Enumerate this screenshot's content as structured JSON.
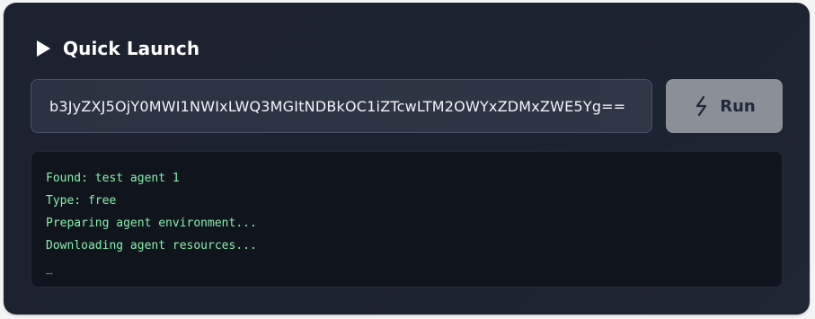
{
  "header": {
    "title": "Quick Launch",
    "icon": "play-icon"
  },
  "launcher": {
    "key_value": "b3JyZXJ5OjY0MWI1NWIxLWQ3MGItNDBkOC1iZTcwLTM2OWYxZDMxZWE5Yg==",
    "run_label": "Run",
    "run_icon": "lightning-icon"
  },
  "console": {
    "lines": [
      "Found: test agent 1",
      "Type: free",
      "Preparing agent environment...",
      "Downloading agent resources..."
    ],
    "cursor": "_"
  },
  "colors": {
    "card_bg": "#1c2230",
    "console_bg": "#10141d",
    "console_text": "#86efac",
    "button_bg": "#8a8f98",
    "title_text": "#ffffff"
  }
}
